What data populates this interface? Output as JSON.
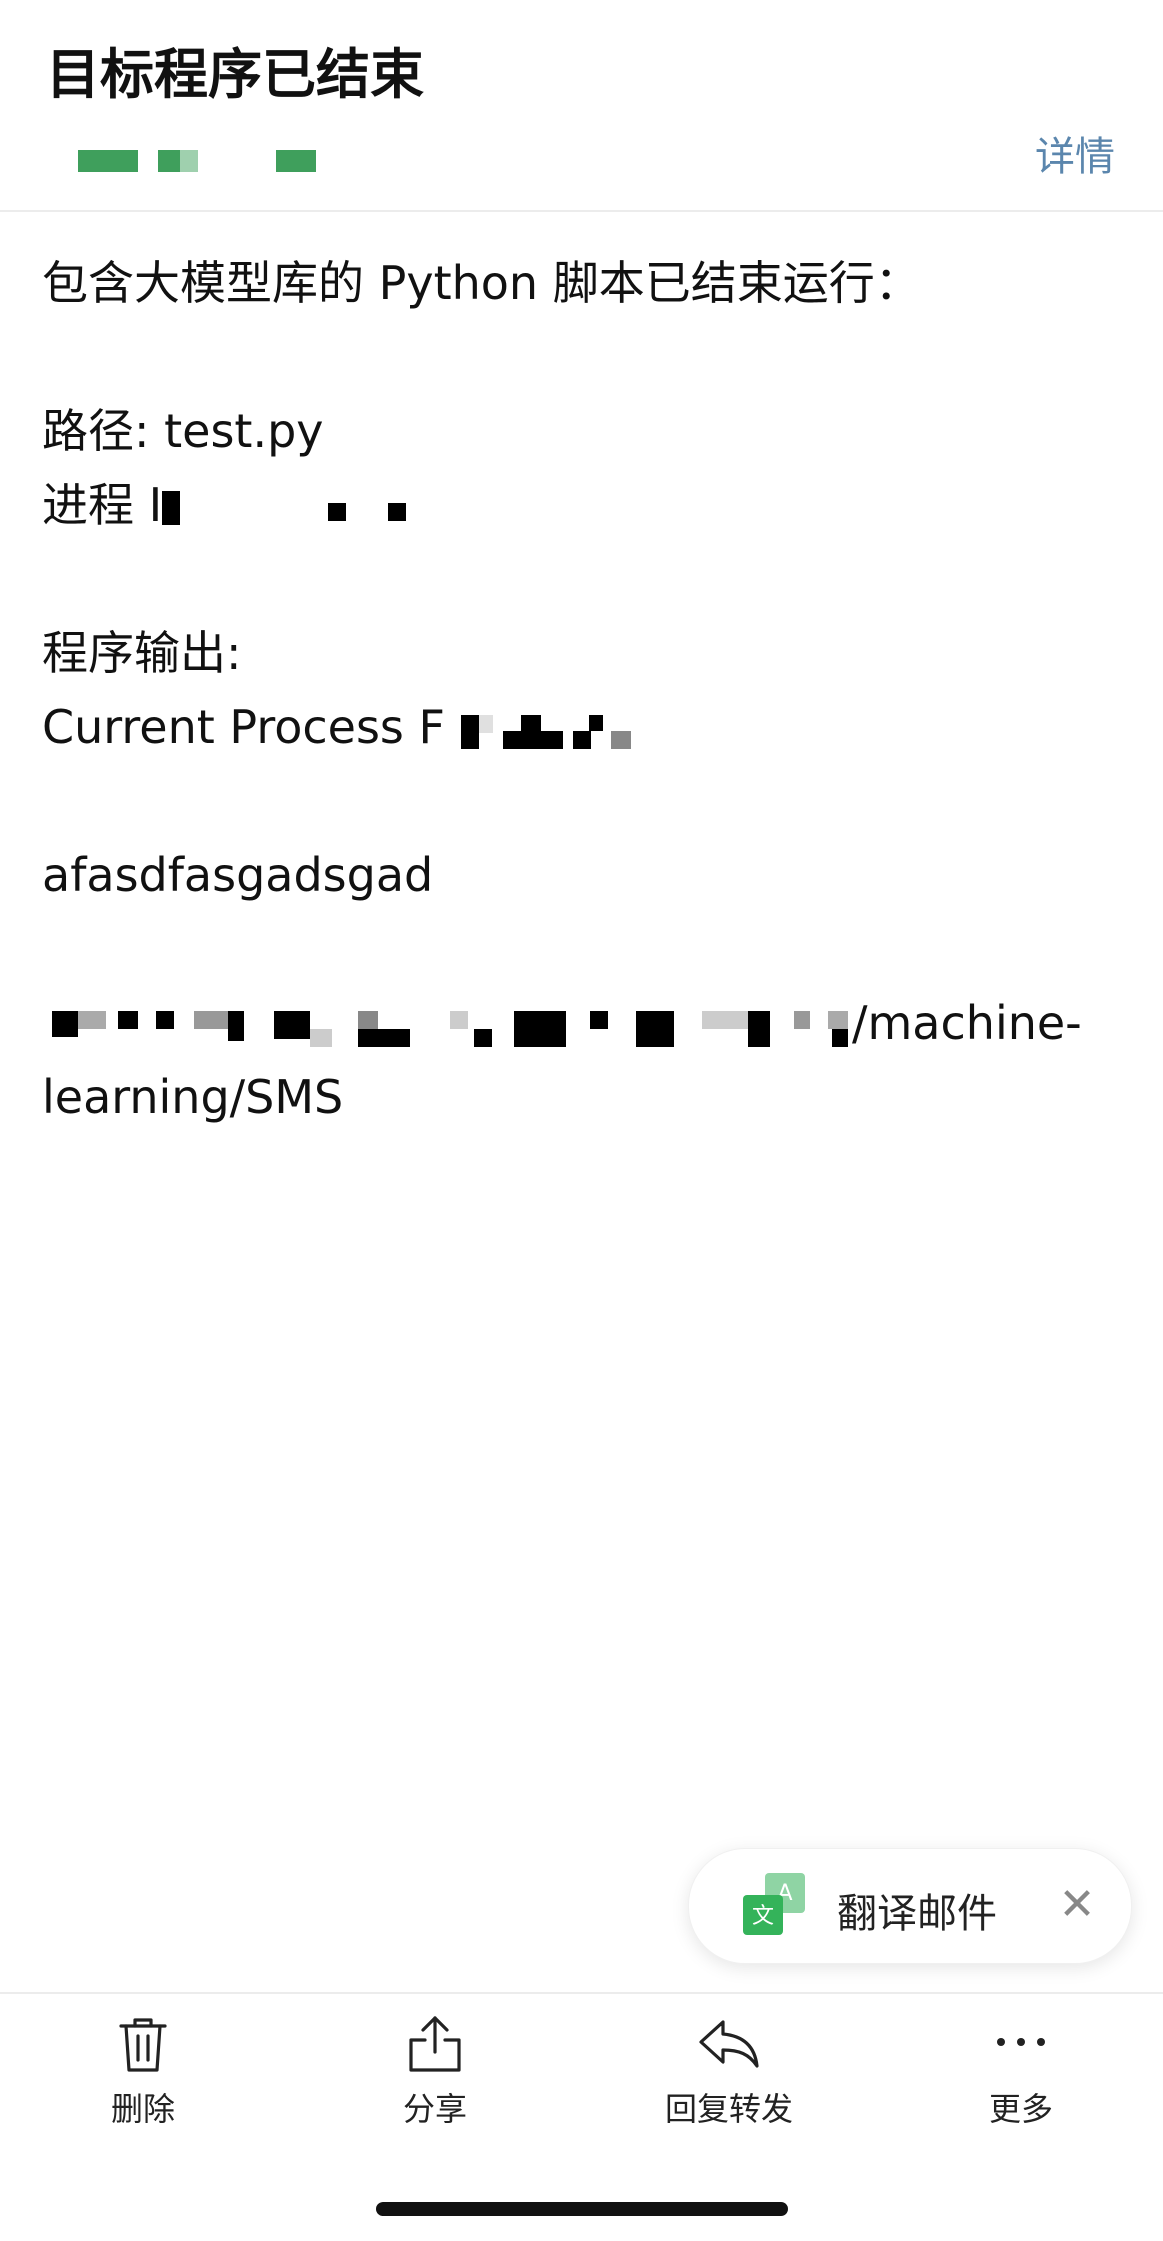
{
  "header": {
    "title": "目标程序已结束",
    "details_label": "详情"
  },
  "message": {
    "intro": "包含大模型库的 Python 脚本已结束运行：",
    "path_line": "路径: test.py",
    "pid_prefix": "进程 I",
    "output_heading": "程序输出:",
    "current_process_prefix": "Current Process F",
    "output_text": "afasdfasgadsgad",
    "path_suffix": "/machine-",
    "path_last_line": "learning/SMS"
  },
  "translate_banner": {
    "label": "翻译邮件",
    "icon_letters": {
      "back": "A",
      "front": "文"
    },
    "close_glyph": "✕",
    "colors": {
      "back": "#8fd4a4",
      "front": "#34b35a"
    }
  },
  "toolbar": {
    "items": [
      {
        "label": "删除",
        "icon": "trash-icon"
      },
      {
        "label": "分享",
        "icon": "share-icon"
      },
      {
        "label": "回复转发",
        "icon": "reply-icon"
      },
      {
        "label": "更多",
        "icon": "more-icon"
      }
    ]
  },
  "colors": {
    "accent_link": "#5b86ad",
    "redaction_green": "#3f9f5c"
  }
}
